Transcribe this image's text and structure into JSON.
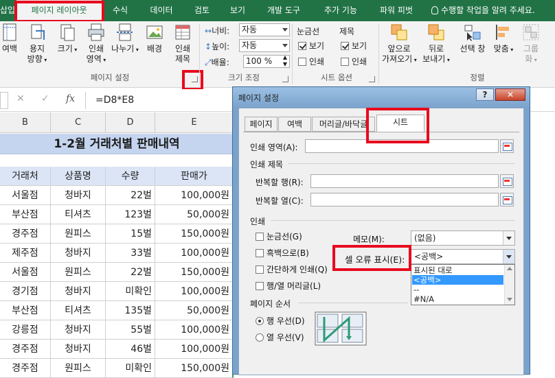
{
  "ribbon_tabs": [
    "삽입",
    "페이지 레이아웃",
    "수식",
    "데이터",
    "검토",
    "보기",
    "개발 도구",
    "추가 기능",
    "파워 피벗",
    "수행할 작업을 알려 주세요."
  ],
  "ribbon": {
    "page_setup": {
      "margins": "여백",
      "orientation_1": "용지",
      "orientation_2": "방향",
      "size": "크기",
      "print_area_1": "인쇄",
      "print_area_2": "영역",
      "breaks": "나누기",
      "background": "배경",
      "print_titles_1": "인쇄",
      "print_titles_2": "제목",
      "group_label": "페이지 설정"
    },
    "scale": {
      "width_label": "너비:",
      "width_value": "자동",
      "height_label": "높이:",
      "height_value": "자동",
      "scale_label": "배율:",
      "scale_value": "100 %",
      "group_label": "크기 조정"
    },
    "sheet_options": {
      "gridlines": "눈금선",
      "headings": "제목",
      "view": "보기",
      "print": "인쇄",
      "group_label": "시트 옵션"
    },
    "arrange": {
      "bring_forward_1": "앞으로",
      "bring_forward_2": "가져오기",
      "send_backward_1": "뒤로",
      "send_backward_2": "보내기",
      "selection_pane": "선택 창",
      "align": "맞춤",
      "group_1": "그룹",
      "group_2": "화",
      "group_label": "정렬"
    }
  },
  "formula_bar": {
    "cancel": "✕",
    "enter": "✓",
    "fx": "fx",
    "formula": "=D8*E8"
  },
  "sheet": {
    "columns": [
      "B",
      "C",
      "D",
      "E"
    ],
    "title": "1-2월 거래처별 판매내역",
    "headers": [
      "거래처",
      "상품명",
      "수량",
      "판매가"
    ],
    "rows": [
      [
        "서울점",
        "청바지",
        "22벌",
        "100,000원"
      ],
      [
        "부산점",
        "티셔츠",
        "123벌",
        "50,000원"
      ],
      [
        "경주점",
        "원피스",
        "15벌",
        "150,000원"
      ],
      [
        "제주점",
        "청바지",
        "33벌",
        "100,000원"
      ],
      [
        "서울점",
        "원피스",
        "22벌",
        "150,000원"
      ],
      [
        "경기점",
        "청바지",
        "미확인",
        "100,000원"
      ],
      [
        "부산점",
        "티셔츠",
        "135벌",
        "50,000원"
      ],
      [
        "강릉점",
        "청바지",
        "55벌",
        "100,000원"
      ],
      [
        "경주점",
        "청바지",
        "46벌",
        "100,000원"
      ],
      [
        "경주점",
        "원피스",
        "미확인",
        "150,000원"
      ]
    ]
  },
  "dialog": {
    "title": "페이지 설정",
    "help": "?",
    "close": "✕",
    "tabs": [
      "페이지",
      "여백",
      "머리글/바닥글",
      "시트"
    ],
    "print_area_label": "인쇄 영역(A):",
    "print_titles_label": "인쇄 제목",
    "rows_repeat_label": "반복할 행(R):",
    "cols_repeat_label": "반복할 열(C):",
    "print_section_label": "인쇄",
    "gridlines_label": "눈금선(G)",
    "bw_label": "흑백으로(B)",
    "draft_label": "간단하게 인쇄(Q)",
    "headings_label": "행/열 머리글(L)",
    "comments_label": "메모(M):",
    "comments_value": "(없음)",
    "errors_label": "셀 오류 표시(E):",
    "errors_value": "<공백>",
    "errors_options": [
      "표시된 대로",
      "<공백>",
      "--",
      "#N/A"
    ],
    "page_order_label": "페이지 순서",
    "down_then_over": "행 우선(D)",
    "over_then_down": "열 우선(V)"
  },
  "colors": {
    "ribbon_green": "#217346",
    "highlight_red": "#e8091e",
    "title_fill": "#c5d5ef",
    "selection_blue": "#3399ff"
  }
}
